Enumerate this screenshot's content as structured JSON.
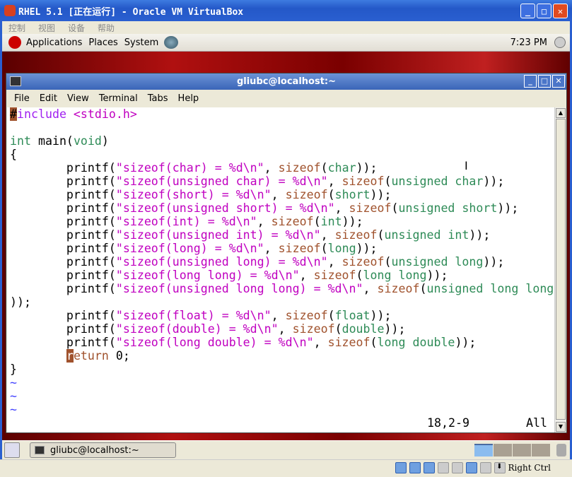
{
  "vbox": {
    "title": "RHEL 5.1 [正在运行] - Oracle VM VirtualBox",
    "menu": [
      "控制",
      "视图",
      "设备",
      "帮助"
    ],
    "host_key": "Right Ctrl"
  },
  "panel": {
    "items": [
      "Applications",
      "Places",
      "System"
    ],
    "clock": "7:23 PM"
  },
  "terminal": {
    "title": "gliubc@localhost:~",
    "menu": [
      "File",
      "Edit",
      "View",
      "Terminal",
      "Tabs",
      "Help"
    ],
    "lines": [
      [
        [
          "#",
          "curpp"
        ],
        [
          "include",
          "p"
        ],
        [
          " <stdio.h>",
          "s"
        ]
      ],
      [],
      [
        [
          "int",
          "t"
        ],
        [
          " main(",
          "n"
        ],
        [
          "void",
          "t"
        ],
        [
          ")",
          "n"
        ]
      ],
      [
        [
          "{",
          "n"
        ]
      ],
      [
        [
          "        printf(",
          "n"
        ],
        [
          "\"sizeof(char) = %d\\n\"",
          "s"
        ],
        [
          ", ",
          "n"
        ],
        [
          "sizeof",
          "k"
        ],
        [
          "(",
          "n"
        ],
        [
          "char",
          "t"
        ],
        [
          "));",
          "n"
        ]
      ],
      [
        [
          "        printf(",
          "n"
        ],
        [
          "\"sizeof(unsigned char) = %d\\n\"",
          "s"
        ],
        [
          ", ",
          "n"
        ],
        [
          "sizeof",
          "k"
        ],
        [
          "(",
          "n"
        ],
        [
          "unsigned char",
          "t"
        ],
        [
          "));",
          "n"
        ]
      ],
      [
        [
          "        printf(",
          "n"
        ],
        [
          "\"sizeof(short) = %d\\n\"",
          "s"
        ],
        [
          ", ",
          "n"
        ],
        [
          "sizeof",
          "k"
        ],
        [
          "(",
          "n"
        ],
        [
          "short",
          "t"
        ],
        [
          "));",
          "n"
        ]
      ],
      [
        [
          "        printf(",
          "n"
        ],
        [
          "\"sizeof(unsigned short) = %d\\n\"",
          "s"
        ],
        [
          ", ",
          "n"
        ],
        [
          "sizeof",
          "k"
        ],
        [
          "(",
          "n"
        ],
        [
          "unsigned short",
          "t"
        ],
        [
          "));",
          "n"
        ]
      ],
      [
        [
          "        printf(",
          "n"
        ],
        [
          "\"sizeof(int) = %d\\n\"",
          "s"
        ],
        [
          ", ",
          "n"
        ],
        [
          "sizeof",
          "k"
        ],
        [
          "(",
          "n"
        ],
        [
          "int",
          "t"
        ],
        [
          "));",
          "n"
        ]
      ],
      [
        [
          "        printf(",
          "n"
        ],
        [
          "\"sizeof(unsigned int) = %d\\n\"",
          "s"
        ],
        [
          ", ",
          "n"
        ],
        [
          "sizeof",
          "k"
        ],
        [
          "(",
          "n"
        ],
        [
          "unsigned int",
          "t"
        ],
        [
          "));",
          "n"
        ]
      ],
      [
        [
          "        printf(",
          "n"
        ],
        [
          "\"sizeof(long) = %d\\n\"",
          "s"
        ],
        [
          ", ",
          "n"
        ],
        [
          "sizeof",
          "k"
        ],
        [
          "(",
          "n"
        ],
        [
          "long",
          "t"
        ],
        [
          "));",
          "n"
        ]
      ],
      [
        [
          "        printf(",
          "n"
        ],
        [
          "\"sizeof(unsigned long) = %d\\n\"",
          "s"
        ],
        [
          ", ",
          "n"
        ],
        [
          "sizeof",
          "k"
        ],
        [
          "(",
          "n"
        ],
        [
          "unsigned long",
          "t"
        ],
        [
          "));",
          "n"
        ]
      ],
      [
        [
          "        printf(",
          "n"
        ],
        [
          "\"sizeof(long long) = %d\\n\"",
          "s"
        ],
        [
          ", ",
          "n"
        ],
        [
          "sizeof",
          "k"
        ],
        [
          "(",
          "n"
        ],
        [
          "long long",
          "t"
        ],
        [
          "));",
          "n"
        ]
      ],
      [
        [
          "        printf(",
          "n"
        ],
        [
          "\"sizeof(unsigned long long) = %d\\n\"",
          "s"
        ],
        [
          ", ",
          "n"
        ],
        [
          "sizeof",
          "k"
        ],
        [
          "(",
          "n"
        ],
        [
          "unsigned long long",
          "t"
        ]
      ],
      [
        [
          "));",
          "n"
        ]
      ],
      [
        [
          "        printf(",
          "n"
        ],
        [
          "\"sizeof(float) = %d\\n\"",
          "s"
        ],
        [
          ", ",
          "n"
        ],
        [
          "sizeof",
          "k"
        ],
        [
          "(",
          "n"
        ],
        [
          "float",
          "t"
        ],
        [
          "));",
          "n"
        ]
      ],
      [
        [
          "        printf(",
          "n"
        ],
        [
          "\"sizeof(double) = %d\\n\"",
          "s"
        ],
        [
          ", ",
          "n"
        ],
        [
          "sizeof",
          "k"
        ],
        [
          "(",
          "n"
        ],
        [
          "double",
          "t"
        ],
        [
          "));",
          "n"
        ]
      ],
      [
        [
          "        printf(",
          "n"
        ],
        [
          "\"sizeof(long double) = %d\\n\"",
          "s"
        ],
        [
          ", ",
          "n"
        ],
        [
          "sizeof",
          "k"
        ],
        [
          "(",
          "n"
        ],
        [
          "long double",
          "t"
        ],
        [
          "));",
          "n"
        ]
      ],
      [
        [
          "        ",
          "n"
        ],
        [
          "r",
          "cur"
        ],
        [
          "eturn",
          "k"
        ],
        [
          " 0;",
          "n"
        ]
      ],
      [
        [
          "}",
          "n"
        ]
      ],
      [
        [
          "~",
          "tilde"
        ]
      ],
      [
        [
          "~",
          "tilde"
        ]
      ],
      [
        [
          "~",
          "tilde"
        ]
      ]
    ],
    "cursor_pos": "18,2-9",
    "scroll_status": "All"
  },
  "taskbar": {
    "task": "gliubc@localhost:~"
  }
}
